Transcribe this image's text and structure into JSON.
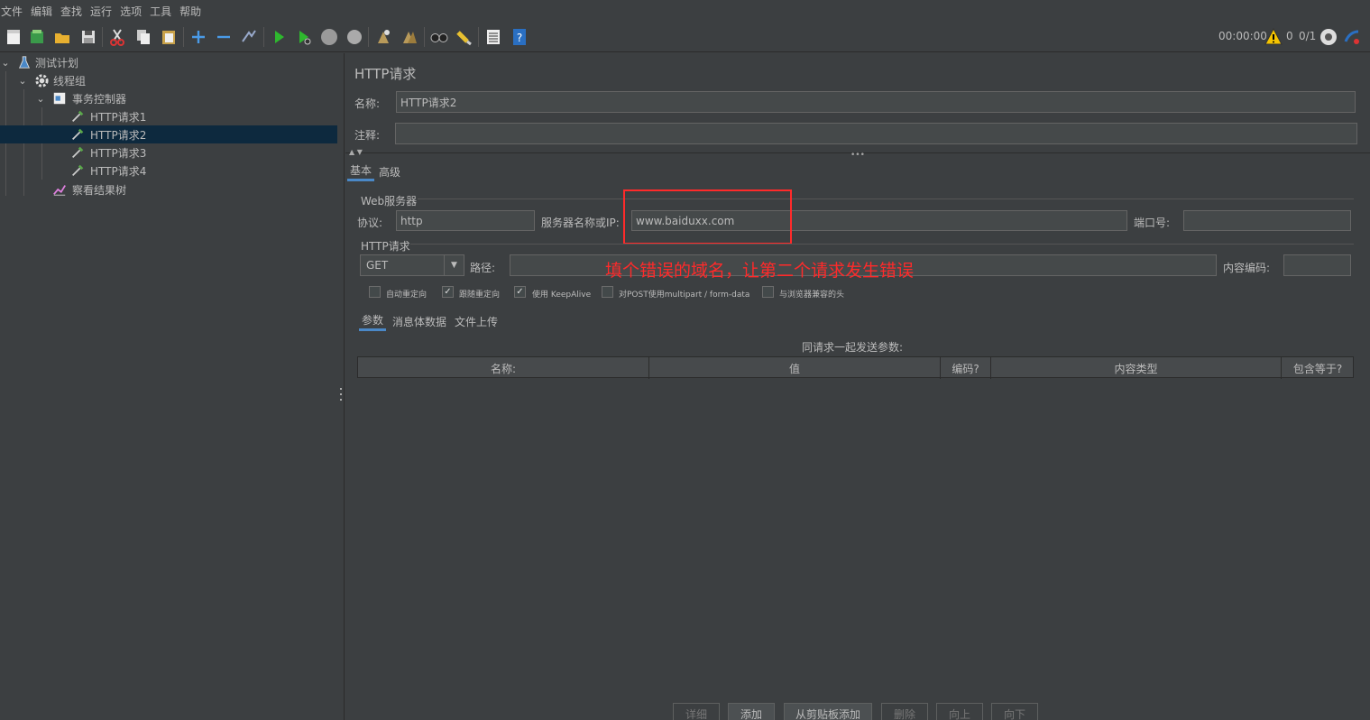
{
  "menubar": {
    "items": [
      "文件",
      "编辑",
      "查找",
      "运行",
      "选项",
      "工具",
      "帮助"
    ]
  },
  "toolbar": {
    "icons": [
      "new-icon",
      "templates-icon",
      "open-icon",
      "save-icon",
      "cut-icon",
      "copy-icon",
      "paste-icon",
      "expand-icon",
      "collapse-icon",
      "toggle-icon",
      "start-icon",
      "start-no-pause-icon",
      "stop-icon",
      "shutdown-icon",
      "clear-icon",
      "clear-all-icon",
      "search-icon",
      "reset-search-icon",
      "function-helper-icon",
      "help-icon"
    ],
    "timer": "00:00:00",
    "warning_count": "0",
    "thread_ratio": "0/1"
  },
  "tree": {
    "nodes": [
      {
        "label": "测试计划"
      },
      {
        "label": "线程组"
      },
      {
        "label": "事务控制器"
      },
      {
        "label": "HTTP请求1"
      },
      {
        "label": "HTTP请求2"
      },
      {
        "label": "HTTP请求3"
      },
      {
        "label": "HTTP请求4"
      },
      {
        "label": "察看结果树"
      }
    ]
  },
  "panel": {
    "title": "HTTP请求",
    "name_label": "名称:",
    "name_value": "HTTP请求2",
    "comment_label": "注释:",
    "comment_value": "",
    "tabs": [
      "基本",
      "高级"
    ],
    "web_server_title": "Web服务器",
    "protocol_label": "协议:",
    "protocol_value": "http",
    "server_label": "服务器名称或IP:",
    "server_value": "www.baiduxx.com",
    "port_label": "端口号:",
    "port_value": "",
    "http_request_title": "HTTP请求",
    "method_value": "GET",
    "path_label": "路径:",
    "path_value": "",
    "encoding_label": "内容编码:",
    "encoding_value": "",
    "annotation": "填个错误的域名，让第二个请求发生错误",
    "checkboxes": [
      {
        "label": "自动重定向",
        "checked": false
      },
      {
        "label": "跟随重定向",
        "checked": true
      },
      {
        "label": "使用 KeepAlive",
        "checked": true
      },
      {
        "label": "对POST使用multipart / form-data",
        "checked": false
      },
      {
        "label": "与浏览器兼容的头",
        "checked": false
      }
    ],
    "subtabs": [
      "参数",
      "消息体数据",
      "文件上传"
    ],
    "params_caption": "同请求一起发送参数:",
    "columns": [
      "名称:",
      "值",
      "编码?",
      "内容类型",
      "包含等于?"
    ],
    "buttons": [
      "详细",
      "添加",
      "从剪贴板添加",
      "删除",
      "向上",
      "向下"
    ]
  },
  "colors": {
    "background": "#3c3f41",
    "selection": "#0d293e",
    "accent_tab": "#4a88c7",
    "annotation": "#ff2a2a"
  }
}
